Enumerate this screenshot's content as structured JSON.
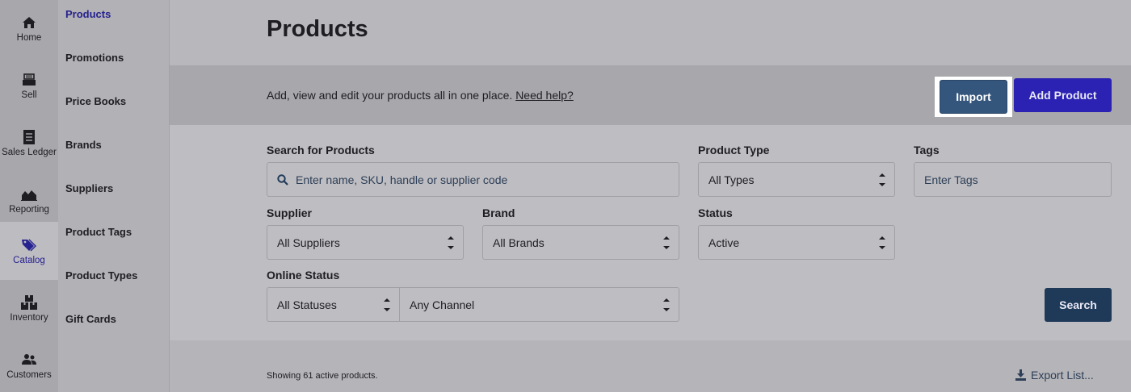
{
  "rail": {
    "items": [
      {
        "label": "Home",
        "icon": "home-icon"
      },
      {
        "label": "Sell",
        "icon": "register-icon"
      },
      {
        "label": "Sales Ledger",
        "icon": "ledger-icon"
      },
      {
        "label": "Reporting",
        "icon": "chart-icon"
      },
      {
        "label": "Catalog",
        "icon": "tag-icon",
        "active": true
      },
      {
        "label": "Inventory",
        "icon": "boxes-icon"
      },
      {
        "label": "Customers",
        "icon": "people-icon"
      }
    ]
  },
  "subnav": {
    "items": [
      {
        "label": "Products",
        "active": true
      },
      {
        "label": "Promotions"
      },
      {
        "label": "Price Books"
      },
      {
        "label": "Brands"
      },
      {
        "label": "Suppliers"
      },
      {
        "label": "Product Tags"
      },
      {
        "label": "Product Types"
      },
      {
        "label": "Gift Cards"
      }
    ]
  },
  "page": {
    "title": "Products",
    "banner_text": "Add, view and edit your products all in one place.",
    "help_link": "Need help?",
    "import_label": "Import",
    "add_label": "Add Product"
  },
  "filters": {
    "search_label": "Search for Products",
    "search_placeholder": "Enter name, SKU, handle or supplier code",
    "type_label": "Product Type",
    "type_value": "All Types",
    "tags_label": "Tags",
    "tags_placeholder": "Enter Tags",
    "supplier_label": "Supplier",
    "supplier_value": "All Suppliers",
    "brand_label": "Brand",
    "brand_value": "All Brands",
    "status_label": "Status",
    "status_value": "Active",
    "online_label": "Online Status",
    "online_value": "All Statuses",
    "channel_value": "Any Channel",
    "search_button": "Search"
  },
  "footer": {
    "showing": "Showing 61 active products.",
    "export": "Export List..."
  },
  "colors": {
    "accent": "#26228f",
    "import_btn": "#34557c",
    "add_btn": "#2b22b3",
    "search_btn": "#1f3a59"
  }
}
